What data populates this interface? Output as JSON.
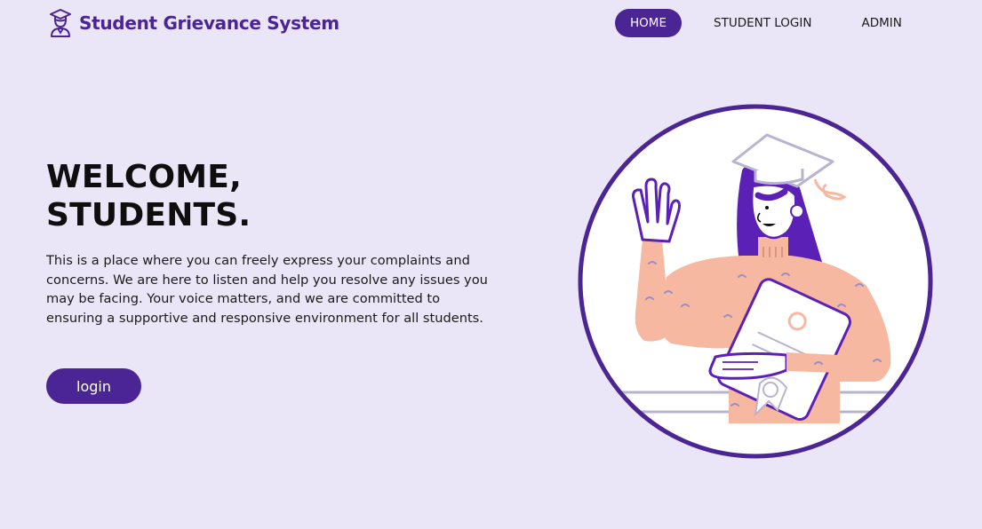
{
  "header": {
    "brand_icon": "graduate-icon",
    "title": "Student Grievance System"
  },
  "nav": {
    "items": [
      {
        "label": "HOME",
        "active": true
      },
      {
        "label": "STUDENT LOGIN",
        "active": false
      },
      {
        "label": "ADMIN",
        "active": false
      }
    ]
  },
  "hero": {
    "title_line1": "WELCOME,",
    "title_line2": "STUDENTS.",
    "description": "This is a place where you can freely express your complaints and concerns. We are here to listen and help you resolve any issues you may be facing. Your voice matters, and we are committed to ensuring a supportive and responsive environment for all students.",
    "login_label": "login"
  },
  "illustration": {
    "name": "graduate-student-waving-illustration"
  },
  "colors": {
    "background": "#ebe6f7",
    "brand_purple": "#4a2593",
    "illustration_purple": "#5b21b6",
    "skin_peach": "#f6b8a0",
    "text_dark": "#111111"
  }
}
